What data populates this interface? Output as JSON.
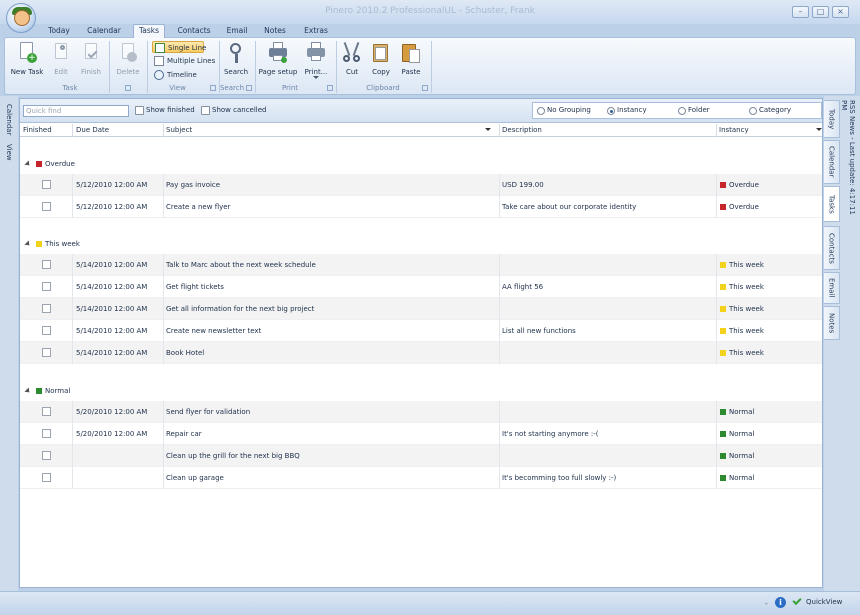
{
  "window": {
    "title": "Pinero 2010.2 ProfessionalUL - Schuster, Frank"
  },
  "ribbon": {
    "tabs": [
      {
        "label": "Today"
      },
      {
        "label": "Calendar"
      },
      {
        "label": "Tasks"
      },
      {
        "label": "Contacts"
      },
      {
        "label": "Email"
      },
      {
        "label": "Notes"
      },
      {
        "label": "Extras"
      }
    ],
    "active_tab": "Tasks",
    "groups": {
      "task": "Task",
      "view": "View",
      "search": "Search",
      "print": "Print",
      "clipboard": "Clipboard"
    },
    "buttons": {
      "new_task": "New Task",
      "edit": "Edit",
      "finish": "Finish",
      "delete": "Delete",
      "single_line": "Single Line",
      "multiple_lines": "Multiple Lines",
      "timeline": "Timeline",
      "search": "Search",
      "page_setup": "Page setup",
      "print": "Print...",
      "cut": "Cut",
      "copy": "Copy",
      "paste": "Paste"
    }
  },
  "left_nav": {
    "calendar": "Calendar",
    "view": "View"
  },
  "right_nav": {
    "rss": "RSS News - Last update: 4:17:11 PM",
    "tabs": [
      "Today",
      "Calendar",
      "Tasks",
      "Contacts",
      "Email",
      "Notes"
    ]
  },
  "toolbar": {
    "quick_find_placeholder": "Quick find",
    "show_finished": "Show finished",
    "show_cancelled": "Show cancelled"
  },
  "grouping": {
    "options": [
      "No Grouping",
      "Instancy",
      "Folder",
      "Category"
    ],
    "selected": "Instancy"
  },
  "columns": {
    "finished": "Finished",
    "due_date": "Due Date",
    "subject": "Subject",
    "description": "Description",
    "instancy": "Instancy"
  },
  "groups": [
    {
      "label": "Overdue",
      "color": "#c8242b",
      "rows": [
        {
          "due": "5/12/2010 12:00 AM",
          "subject": "Pay gas invoice",
          "description": "USD 199.00",
          "instancy": "Overdue"
        },
        {
          "due": "5/12/2010 12:00 AM",
          "subject": "Create a new flyer",
          "description": "Take care about our corporate identity",
          "instancy": "Overdue"
        }
      ]
    },
    {
      "label": "This week",
      "color": "#f2d21b",
      "rows": [
        {
          "due": "5/14/2010 12:00 AM",
          "subject": "Talk to Marc about the next week schedule",
          "description": "",
          "instancy": "This week"
        },
        {
          "due": "5/14/2010 12:00 AM",
          "subject": "Get flight tickets",
          "description": "AA flight 56",
          "instancy": "This week"
        },
        {
          "due": "5/14/2010 12:00 AM",
          "subject": "Get all information for the next big project",
          "description": "",
          "instancy": "This week"
        },
        {
          "due": "5/14/2010 12:00 AM",
          "subject": "Create new newsletter text",
          "description": "List all new functions",
          "instancy": "This week"
        },
        {
          "due": "5/14/2010 12:00 AM",
          "subject": "Book Hotel",
          "description": "",
          "instancy": "This week"
        }
      ]
    },
    {
      "label": "Normal",
      "color": "#2e8a2e",
      "rows": [
        {
          "due": "5/20/2010 12:00 AM",
          "subject": "Send flyer for validation",
          "description": "",
          "instancy": "Normal"
        },
        {
          "due": "5/20/2010 12:00 AM",
          "subject": "Repair car",
          "description": "It's not starting anymore :-(",
          "instancy": "Normal"
        },
        {
          "due": "",
          "subject": "Clean up the grill for the next big BBQ",
          "description": "",
          "instancy": "Normal"
        },
        {
          "due": "",
          "subject": "Clean up garage",
          "description": "It's becomming too full slowly :-)",
          "instancy": "Normal"
        }
      ]
    }
  ],
  "status": {
    "quickview": "QuickView"
  }
}
